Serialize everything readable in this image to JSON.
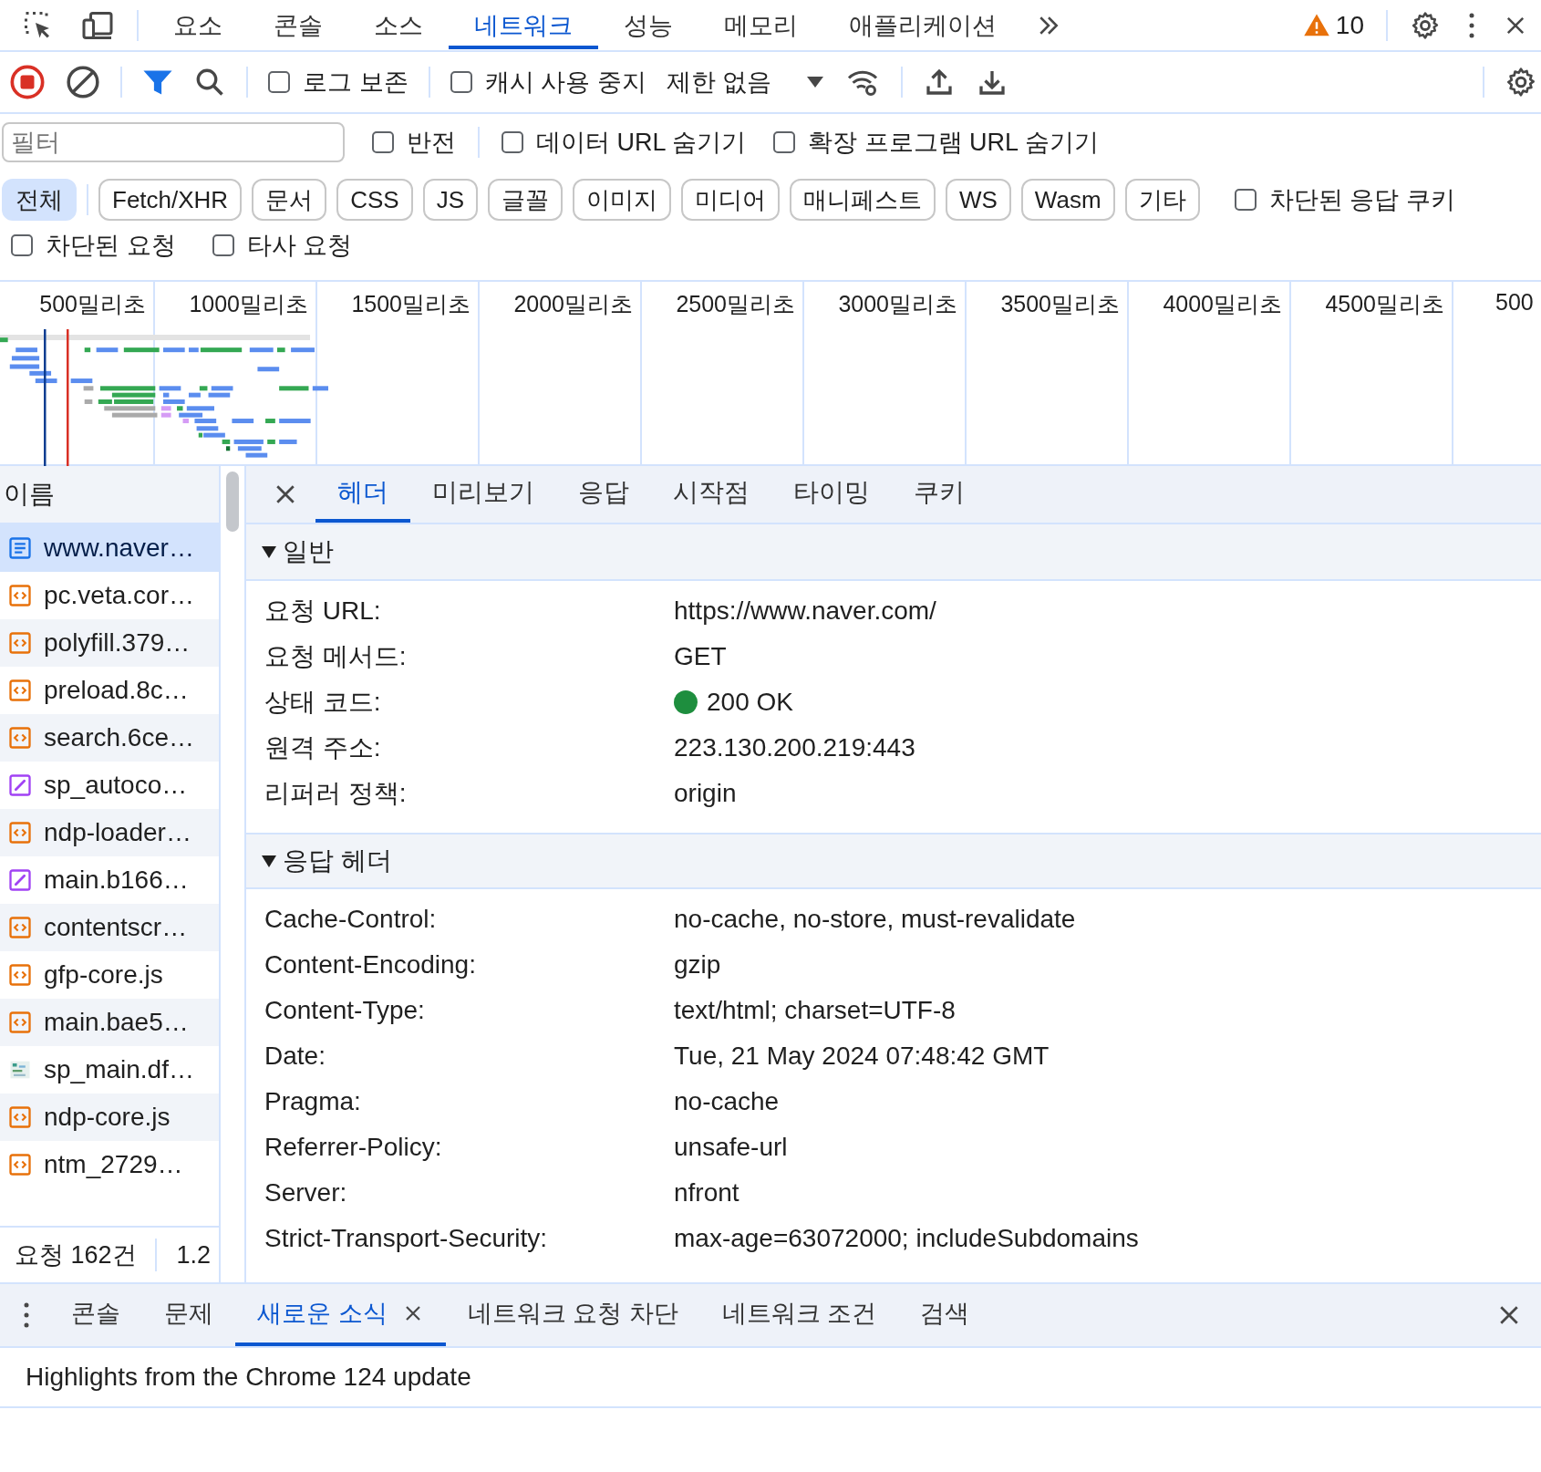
{
  "top_tabs": [
    {
      "label": "요소",
      "selected": false
    },
    {
      "label": "콘솔",
      "selected": false
    },
    {
      "label": "소스",
      "selected": false
    },
    {
      "label": "네트워크",
      "selected": true
    },
    {
      "label": "성능",
      "selected": false
    },
    {
      "label": "메모리",
      "selected": false
    },
    {
      "label": "애플리케이션",
      "selected": false
    }
  ],
  "warnings": {
    "count": "10"
  },
  "toolbar": {
    "recording": true,
    "filter_active": true,
    "options": [
      {
        "label": "로그 보존",
        "checked": false
      },
      {
        "label": "캐시 사용 중지",
        "checked": false
      }
    ],
    "throttling": "제한 없음"
  },
  "filter": {
    "placeholder": "필터",
    "options": [
      {
        "label": "반전",
        "checked": false
      },
      {
        "label": "데이터 URL 숨기기",
        "checked": false
      },
      {
        "label": "확장 프로그램 URL 숨기기",
        "checked": false
      }
    ]
  },
  "type_filters": [
    {
      "label": "전체",
      "selected": true
    },
    {
      "label": "Fetch/XHR",
      "selected": false
    },
    {
      "label": "문서",
      "selected": false
    },
    {
      "label": "CSS",
      "selected": false
    },
    {
      "label": "JS",
      "selected": false
    },
    {
      "label": "글꼴",
      "selected": false
    },
    {
      "label": "이미지",
      "selected": false
    },
    {
      "label": "미디어",
      "selected": false
    },
    {
      "label": "매니페스트",
      "selected": false
    },
    {
      "label": "WS",
      "selected": false
    },
    {
      "label": "Wasm",
      "selected": false
    },
    {
      "label": "기타",
      "selected": false
    }
  ],
  "blocked_response_cookies": {
    "label": "차단된 응답 쿠키",
    "checked": false
  },
  "extra_options": [
    {
      "label": "차단된 요청",
      "checked": false
    },
    {
      "label": "타사 요청",
      "checked": false
    }
  ],
  "overview": {
    "ticks": [
      "500밀리초",
      "1000밀리초",
      "1500밀리초",
      "2000밀리초",
      "2500밀리초",
      "3000밀리초",
      "3500밀리초",
      "4000밀리초",
      "4500밀리초",
      "500"
    ]
  },
  "requests": {
    "column": "이름",
    "rows": [
      {
        "name": "www.naver…",
        "kind": "document",
        "selected": true
      },
      {
        "name": "pc.veta.cor…",
        "kind": "script",
        "selected": false
      },
      {
        "name": "polyfill.379…",
        "kind": "script",
        "selected": false
      },
      {
        "name": "preload.8c…",
        "kind": "script",
        "selected": false
      },
      {
        "name": "search.6ce…",
        "kind": "script",
        "selected": false
      },
      {
        "name": "sp_autoco…",
        "kind": "style",
        "selected": false
      },
      {
        "name": "ndp-loader…",
        "kind": "script",
        "selected": false
      },
      {
        "name": "main.b166…",
        "kind": "style",
        "selected": false
      },
      {
        "name": "contentscr…",
        "kind": "script",
        "selected": false
      },
      {
        "name": "gfp-core.js",
        "kind": "script",
        "selected": false
      },
      {
        "name": "main.bae5…",
        "kind": "script",
        "selected": false
      },
      {
        "name": "sp_main.df…",
        "kind": "image",
        "selected": false
      },
      {
        "name": "ndp-core.js",
        "kind": "script",
        "selected": false
      },
      {
        "name": "ntm_2729…",
        "kind": "script",
        "selected": false
      }
    ]
  },
  "status_bar": {
    "requests": "요청 162건",
    "transferred": "1.2"
  },
  "details": {
    "tabs": [
      {
        "label": "헤더",
        "selected": true
      },
      {
        "label": "미리보기",
        "selected": false
      },
      {
        "label": "응답",
        "selected": false
      },
      {
        "label": "시작점",
        "selected": false
      },
      {
        "label": "타이밍",
        "selected": false
      },
      {
        "label": "쿠키",
        "selected": false
      }
    ],
    "sections": [
      {
        "title": "일반",
        "expanded": true,
        "rows": [
          {
            "label": "요청 URL:",
            "value": "https://www.naver.com/",
            "kind": "text"
          },
          {
            "label": "요청 메서드:",
            "value": "GET",
            "kind": "text"
          },
          {
            "label": "상태 코드:",
            "value": "200 OK",
            "kind": "status"
          },
          {
            "label": "원격 주소:",
            "value": "223.130.200.219:443",
            "kind": "text"
          },
          {
            "label": "리퍼러 정책:",
            "value": "origin",
            "kind": "text"
          }
        ]
      },
      {
        "title": "응답 헤더",
        "expanded": true,
        "rows": [
          {
            "label": "Cache-Control:",
            "value": "no-cache, no-store, must-revalidate",
            "kind": "text"
          },
          {
            "label": "Content-Encoding:",
            "value": "gzip",
            "kind": "text"
          },
          {
            "label": "Content-Type:",
            "value": "text/html; charset=UTF-8",
            "kind": "text"
          },
          {
            "label": "Date:",
            "value": "Tue, 21 May 2024 07:48:42 GMT",
            "kind": "text"
          },
          {
            "label": "Pragma:",
            "value": "no-cache",
            "kind": "text"
          },
          {
            "label": "Referrer-Policy:",
            "value": "unsafe-url",
            "kind": "text"
          },
          {
            "label": "Server:",
            "value": "nfront",
            "kind": "text"
          },
          {
            "label": "Strict-Transport-Security:",
            "value": "max-age=63072000; includeSubdomains",
            "kind": "text"
          }
        ]
      }
    ]
  },
  "drawer": {
    "tabs": [
      {
        "label": "콘솔",
        "selected": false,
        "closable": false
      },
      {
        "label": "문제",
        "selected": false,
        "closable": false
      },
      {
        "label": "새로운 소식",
        "selected": true,
        "closable": true
      },
      {
        "label": "네트워크 요청 차단",
        "selected": false,
        "closable": false
      },
      {
        "label": "네트워크 조건",
        "selected": false,
        "closable": false
      },
      {
        "label": "검색",
        "selected": false,
        "closable": false
      }
    ],
    "content": "Highlights from the Chrome 124 update"
  }
}
